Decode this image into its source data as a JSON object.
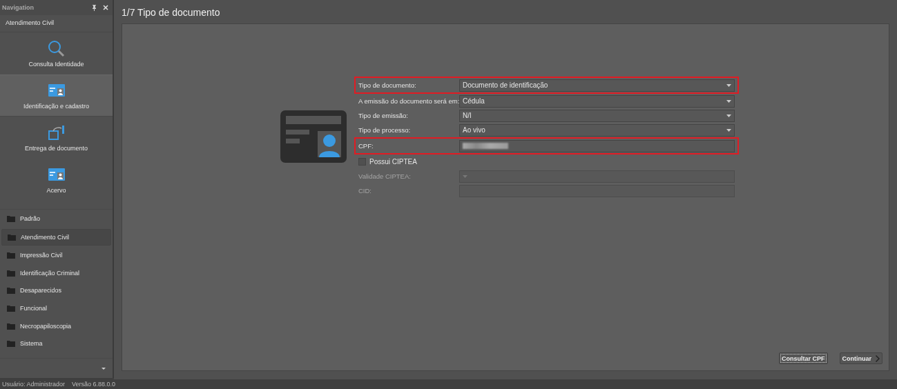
{
  "navigation": {
    "title": "Navigation",
    "section": "Atendimento Civil",
    "actions": [
      {
        "label": "Consulta Identidade",
        "kind": "search",
        "selected": false
      },
      {
        "label": "Identificação e cadastro",
        "kind": "card",
        "selected": true
      },
      {
        "label": "Entrega de documento",
        "kind": "handover",
        "selected": false
      },
      {
        "label": "Acervo",
        "kind": "card",
        "selected": false
      }
    ],
    "groups": [
      {
        "label": "Padrão",
        "selected": false
      },
      {
        "label": "Atendimento Civil",
        "selected": true
      },
      {
        "label": "Impressão Civil",
        "selected": false
      },
      {
        "label": "Identificação Criminal",
        "selected": false
      },
      {
        "label": "Desaparecidos",
        "selected": false
      },
      {
        "label": "Funcional",
        "selected": false
      },
      {
        "label": "Necropapiloscopia",
        "selected": false
      },
      {
        "label": "Sistema",
        "selected": false
      }
    ]
  },
  "page_title": "1/7 Tipo de documento",
  "form": [
    {
      "kind": "select",
      "label": "Tipo de documento:",
      "value": "Documento de identificação",
      "highlighted": true,
      "disabled": false
    },
    {
      "kind": "select",
      "label": "A emissão do documento será em:",
      "value": "Cédula",
      "highlighted": false,
      "disabled": false
    },
    {
      "kind": "select",
      "label": "Tipo de emissão:",
      "value": "N/I",
      "highlighted": false,
      "disabled": false
    },
    {
      "kind": "select",
      "label": "Tipo de processo:",
      "value": "Ao vivo",
      "highlighted": false,
      "disabled": false
    },
    {
      "kind": "redacted",
      "label": "CPF:",
      "highlighted": true,
      "disabled": false
    },
    {
      "kind": "checkbox",
      "label": "Possui CIPTEA",
      "checked": false,
      "highlighted": false,
      "disabled": false
    },
    {
      "kind": "select",
      "label": "Validade CIPTEA:",
      "highlighted": false,
      "disabled": true
    },
    {
      "kind": "text",
      "label": "CID:",
      "highlighted": false,
      "disabled": true
    }
  ],
  "buttons": [
    {
      "label": "Consultar CPF",
      "kind": "focused"
    },
    {
      "label": "Continuar",
      "kind": "next"
    }
  ],
  "status_bar": "Usuário: Administrador    Versão 6.88.0.0"
}
